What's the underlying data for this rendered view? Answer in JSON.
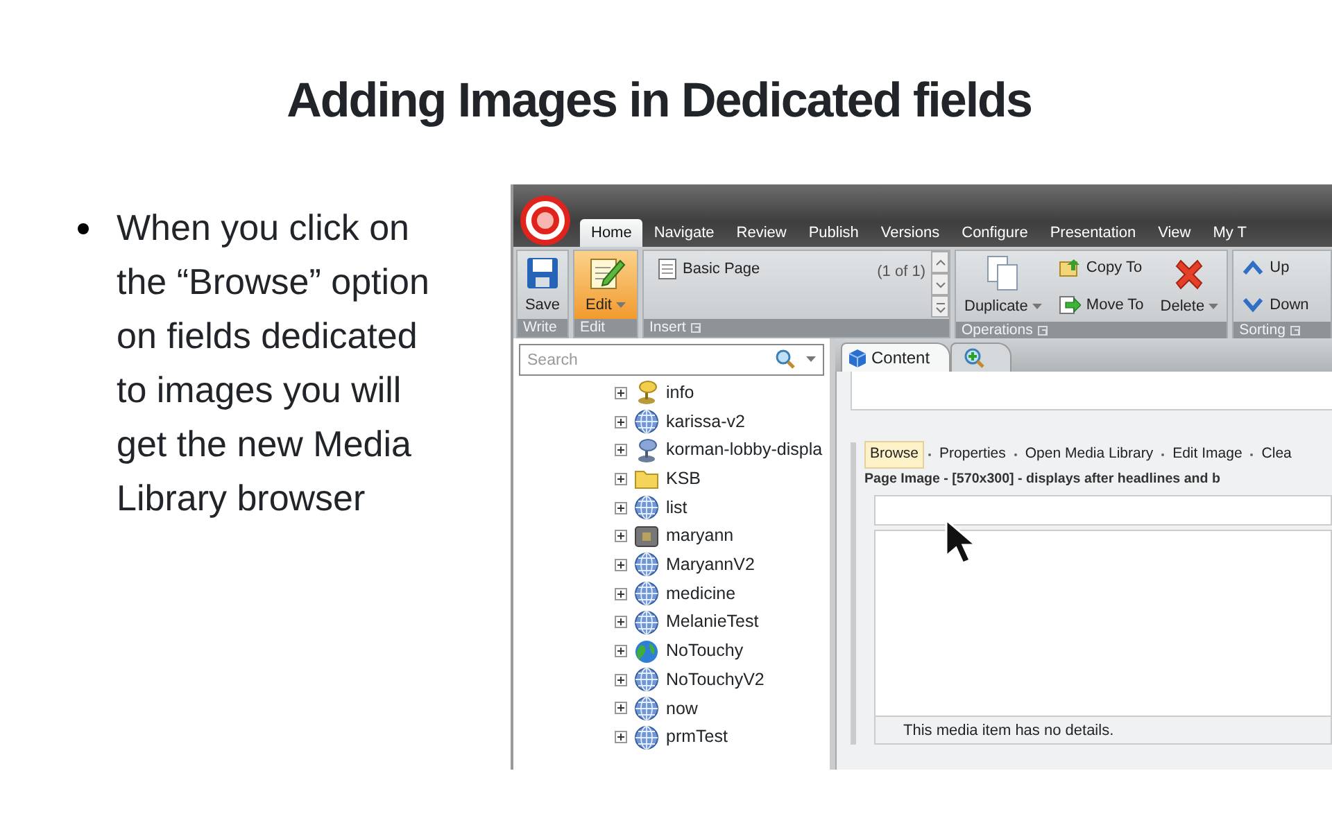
{
  "slide": {
    "title": "Adding Images in Dedicated fields",
    "bullets": [
      "When you click on the “Browse” option on fields dedicated to images you will get the new Media Library browser"
    ]
  },
  "app": {
    "tabs": [
      {
        "label": "Home",
        "selected": true
      },
      {
        "label": "Navigate",
        "selected": false
      },
      {
        "label": "Review",
        "selected": false
      },
      {
        "label": "Publish",
        "selected": false
      },
      {
        "label": "Versions",
        "selected": false
      },
      {
        "label": "Configure",
        "selected": false
      },
      {
        "label": "Presentation",
        "selected": false
      },
      {
        "label": "View",
        "selected": false
      },
      {
        "label": "My T",
        "selected": false
      }
    ],
    "ribbon": [
      {
        "label": "Write",
        "items": [
          {
            "kind": "save",
            "label": "Save",
            "active": false
          }
        ]
      },
      {
        "label": "Edit",
        "items": [
          {
            "kind": "edit",
            "label": "Edit",
            "active": true
          }
        ]
      },
      {
        "label": "Insert",
        "items": [
          {
            "kind": "gallery",
            "label": "Basic Page",
            "count": "(1 of 1)"
          }
        ]
      },
      {
        "label": "Operations",
        "items": [
          {
            "kind": "duplicate",
            "label": "Duplicate"
          },
          {
            "kind": "copy",
            "label": "Copy To"
          },
          {
            "kind": "move",
            "label": "Move To"
          },
          {
            "kind": "delete",
            "label": "Delete"
          }
        ]
      },
      {
        "label": "Sorting",
        "items": [
          {
            "kind": "up",
            "label": "Up"
          },
          {
            "kind": "down",
            "label": "Down"
          }
        ]
      }
    ],
    "search": {
      "placeholder": "Search"
    },
    "tree": [
      {
        "label": "info",
        "kind": "userfolder"
      },
      {
        "label": "karissa-v2",
        "kind": "site"
      },
      {
        "label": "korman-lobby-displa",
        "kind": "kiosk"
      },
      {
        "label": "KSB",
        "kind": "folder"
      },
      {
        "label": "list",
        "kind": "site"
      },
      {
        "label": "maryann",
        "kind": "archive"
      },
      {
        "label": "MaryannV2",
        "kind": "site"
      },
      {
        "label": "medicine",
        "kind": "site"
      },
      {
        "label": "MelanieTest",
        "kind": "site"
      },
      {
        "label": "NoTouchy",
        "kind": "planet"
      },
      {
        "label": "NoTouchyV2",
        "kind": "site"
      },
      {
        "label": "now",
        "kind": "site"
      },
      {
        "label": "prmTest",
        "kind": "site"
      }
    ],
    "editor_tabs": [
      {
        "kind": "content",
        "label": "Content",
        "selected": true
      },
      {
        "kind": "search",
        "selected": false
      }
    ],
    "field": {
      "actions": [
        {
          "label": "Browse",
          "hover": true
        },
        {
          "label": "Properties",
          "hover": false
        },
        {
          "label": "Open Media Library",
          "hover": false
        },
        {
          "label": "Edit Image",
          "hover": false
        },
        {
          "label": "Clea",
          "hover": false
        }
      ],
      "label": "Page Image - [570x300] - displays after headlines and b",
      "caption": "This media item has no details."
    }
  }
}
